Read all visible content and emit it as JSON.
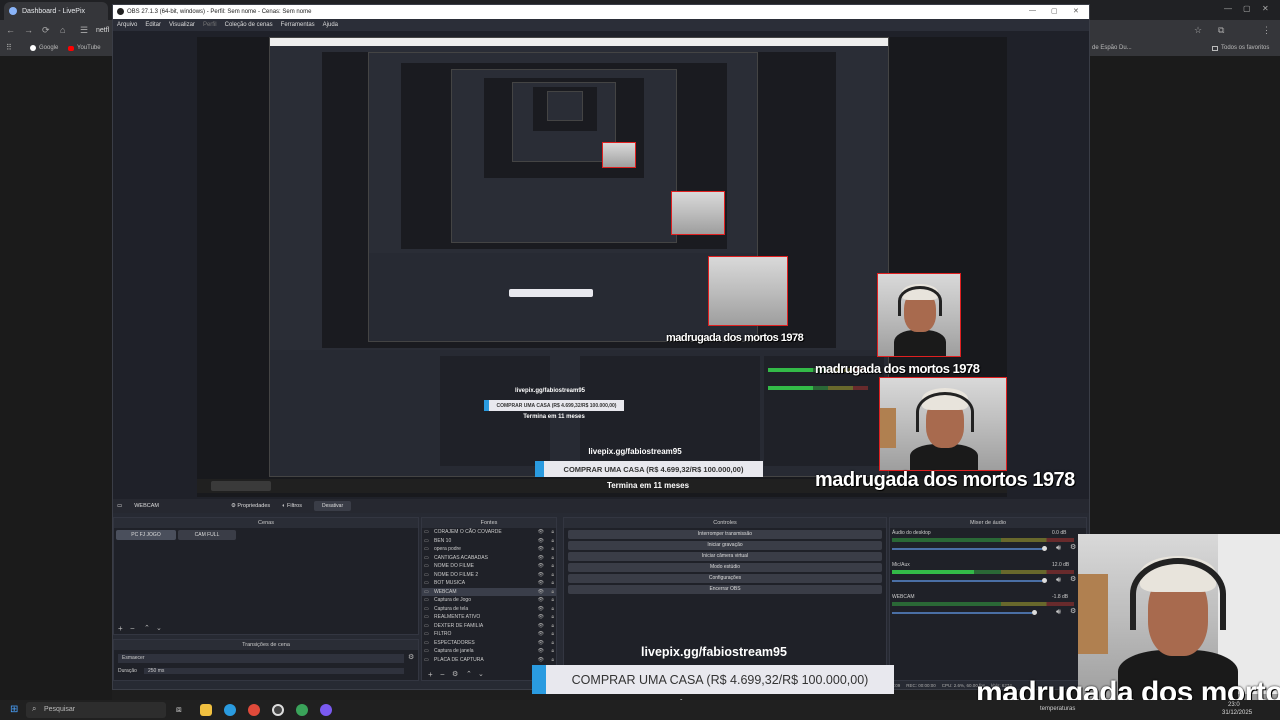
{
  "browser": {
    "tab_title": "Dashboard - LivePix",
    "address_text": "netfl",
    "bookmarks": [
      "Google",
      "YouTube"
    ],
    "right_bookmarks": [
      "de Espão Du...",
      "Todos os favoritos"
    ]
  },
  "obs": {
    "window_title": "OBS 27.1.3 (64-bit, windows) - Perfil: Sem nome - Cenas: Sem nome",
    "menu": [
      "Arquivo",
      "Editar",
      "Visualizar",
      "Perfil",
      "Coleção de cenas",
      "Ferramentas",
      "Ajuda"
    ],
    "source_bar": {
      "source_name": "WEBCAM",
      "properties": "Propriedades",
      "filters": "Filtros",
      "disable": "Desativar"
    },
    "scenes": {
      "header": "Cenas",
      "items": [
        "PC FJ JOGO",
        "CAM FULL"
      ]
    },
    "sources": {
      "header": "Fontes",
      "items": [
        "CORAJEM O CÃO COVARDE",
        "BEN 10",
        "opera podre",
        "CANTIGAS ACABADAS",
        "NOME DO FILME",
        "NOME DO FILME 2",
        "BOT MUSICA",
        "WEBCAM",
        "Captura de Jogo",
        "Captura de tela",
        "REALMENTE ATIVO",
        "DEXTER DE FAMILIA",
        "FILTRO",
        "ESPECTADORES",
        "Captura de janela",
        "PLACA DE CAPTURA"
      ]
    },
    "controls": {
      "header": "Controles",
      "buttons": [
        "Interromper transmissão",
        "Iniciar gravação",
        "Iniciar câmera virtual",
        "Modo estúdio",
        "Configurações",
        "Encerrar OBS"
      ]
    },
    "mixer": {
      "header": "Mixer de áudio",
      "channels": [
        {
          "name": "Áudio do desktop",
          "db": "0.0 dB"
        },
        {
          "name": "Mic/Aux",
          "db": "12.0 dB"
        },
        {
          "name": "WEBCAM",
          "db": "-1.8 dB"
        }
      ]
    },
    "transitions": {
      "header": "Transições de cena",
      "selected": "Esmaecer",
      "duration_label": "Duração",
      "duration_value": "250 ms"
    },
    "status_bar": {
      "time": "00:09",
      "rec": "REC: 00:00:00",
      "cpu": "CPU: 2.6%, 60.00 fps",
      "kbps": "kb/s: 6274"
    }
  },
  "overlay": {
    "url": "livepix.gg/fabiostream95",
    "goal": "COMPRAR UMA CASA (R$ 4.699,32/R$ 100.000,00)",
    "subtitle": "Termina em 11 meses",
    "caption": "madrugada dos mortos 1978"
  },
  "taskbar": {
    "search_placeholder": "Pesquisar",
    "clock_time": "23:0",
    "clock_date": "31/12/2025",
    "status_text": "temperaturas"
  },
  "colors": {
    "obs_bg": "#272a33",
    "accent_blue": "#2a9be0",
    "meter_green": "#38e050",
    "selection_red": "#e02020"
  }
}
